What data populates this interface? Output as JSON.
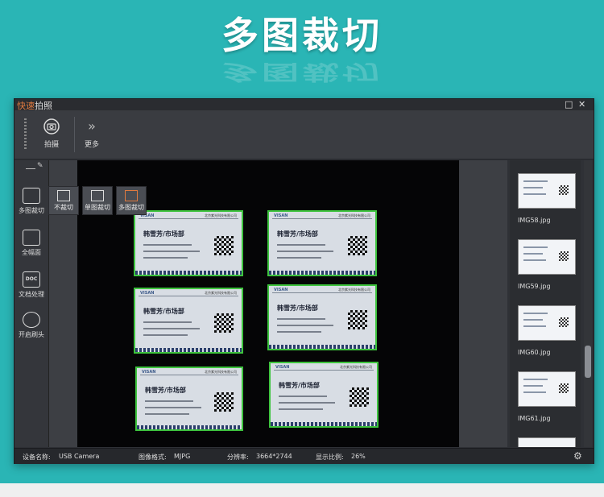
{
  "banner": {
    "title": "多图裁切"
  },
  "window": {
    "title_fast": "快速",
    "title_rest": "拍照",
    "controls": {
      "maximize": "□",
      "close": "✕"
    }
  },
  "toolbar": {
    "capture_label": "拍摄",
    "more_label": "更多",
    "more_icon": "»"
  },
  "left_tools": [
    {
      "label": "多图裁切",
      "icon": "multi-crop-icon"
    },
    {
      "label": "全幅面",
      "icon": "full-frame-icon"
    },
    {
      "label": "文档处理",
      "icon": "doc-process-icon",
      "icon_text": "DOC"
    },
    {
      "label": "开启刷头",
      "icon": "camera-toggle-icon"
    }
  ],
  "crop_menu": [
    {
      "label": "不裁切",
      "icon": "no-crop-icon"
    },
    {
      "label": "单图裁切",
      "icon": "single-crop-icon"
    },
    {
      "label": "多图裁切",
      "icon": "multi-crop-icon"
    }
  ],
  "cards": [
    {
      "logo": "VISAN",
      "company": "北京紫光科技有限公司",
      "name": "韩雪芳/市场部"
    },
    {
      "logo": "VISAN",
      "company": "北京紫光科技有限公司",
      "name": "韩雪芳/市场部"
    },
    {
      "logo": "VISAN",
      "company": "北京紫光科技有限公司",
      "name": "韩雪芳/市场部"
    },
    {
      "logo": "VISAN",
      "company": "北京紫光科技有限公司",
      "name": "韩雪芳/市场部"
    },
    {
      "logo": "VISAN",
      "company": "北京紫光科技有限公司",
      "name": "韩雪芳/市场部"
    },
    {
      "logo": "VISAN",
      "company": "北京紫光科技有限公司",
      "name": "韩雪芳/市场部"
    }
  ],
  "thumbnails": [
    {
      "name": "IMG58.jpg"
    },
    {
      "name": "IMG59.jpg"
    },
    {
      "name": "IMG60.jpg"
    },
    {
      "name": "IMG61.jpg"
    },
    {
      "name": ""
    }
  ],
  "status": {
    "device_label": "设备名称:",
    "device_value": "USB Camera",
    "format_label": "图像格式:",
    "format_value": "MJPG",
    "resolution_label": "分辨率:",
    "resolution_value": "3664*2744",
    "ratio_label": "显示比例:",
    "ratio_value": "26%"
  },
  "colors": {
    "accent": "#2ab5b5",
    "crop_border": "#3ec43e",
    "title_orange": "#e07a3f"
  }
}
